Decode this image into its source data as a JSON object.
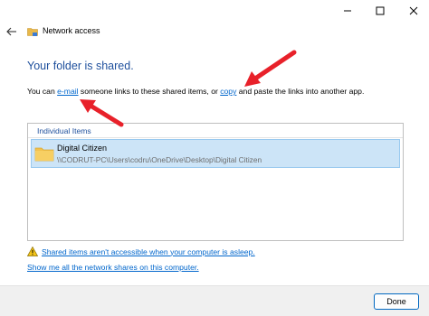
{
  "window": {
    "title": "Network access",
    "controls": {
      "minimize": "—",
      "maximize": "☐",
      "close": "✕"
    }
  },
  "main": {
    "heading": "Your folder is shared.",
    "desc_prefix": "You can ",
    "email_link": "e-mail",
    "desc_middle": " someone links to these shared items, or ",
    "copy_link": "copy",
    "desc_suffix": " and paste the links into another app."
  },
  "items_panel": {
    "header": "Individual Items",
    "items": [
      {
        "name": "Digital Citizen",
        "path": "\\\\CODRUT-PC\\Users\\codru\\OneDrive\\Desktop\\Digital Citizen"
      }
    ]
  },
  "links": {
    "warning": "Shared items aren't accessible when your computer is asleep.",
    "show_shares": "Show me all the network shares on this computer."
  },
  "footer": {
    "done_label": "Done"
  },
  "icons": {
    "back": "back-arrow-icon",
    "app": "network-folder-icon",
    "folder": "folder-icon",
    "warning": "warning-icon"
  },
  "colors": {
    "heading": "#1e4f9c",
    "link": "#0066cc",
    "selection": "#cce4f7",
    "arrow": "#e8212a",
    "done_border": "#0067c0"
  }
}
